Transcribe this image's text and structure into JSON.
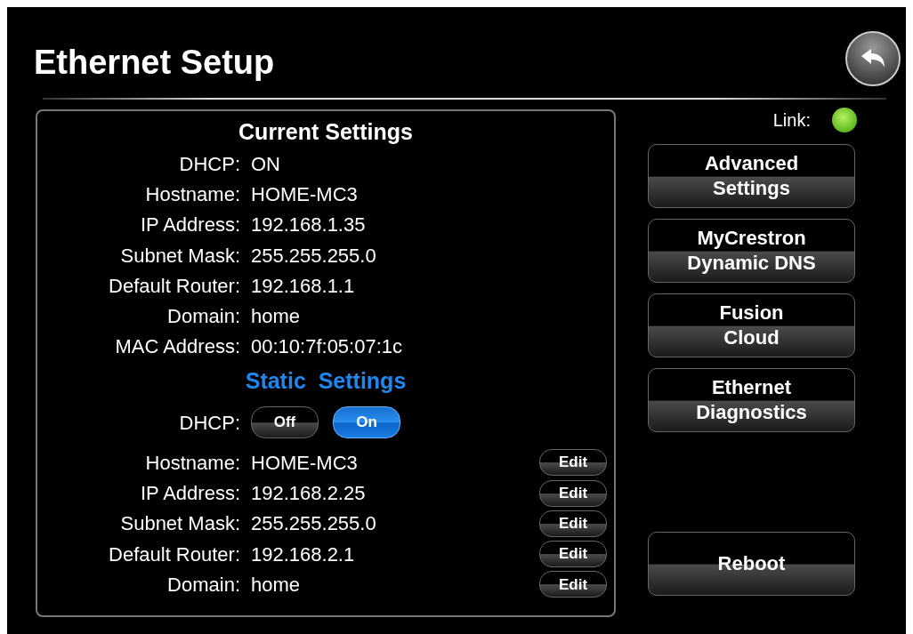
{
  "title": "Ethernet Setup",
  "current": {
    "heading": "Current Settings",
    "rows": [
      {
        "label": "DHCP:",
        "value": "ON"
      },
      {
        "label": "Hostname:",
        "value": "HOME-MC3"
      },
      {
        "label": "IP Address:",
        "value": "192.168.1.35"
      },
      {
        "label": "Subnet Mask:",
        "value": "255.255.255.0"
      },
      {
        "label": "Default Router:",
        "value": "192.168.1.1"
      },
      {
        "label": "Domain:",
        "value": "home"
      },
      {
        "label": "MAC Address:",
        "value": "00:10:7f:05:07:1c"
      }
    ]
  },
  "static": {
    "heading": "Static  Settings",
    "dhcp": {
      "label": "DHCP:",
      "options": [
        {
          "label": "Off",
          "selected": false
        },
        {
          "label": "On",
          "selected": true
        }
      ]
    },
    "rows": [
      {
        "label": "Hostname:",
        "value": "HOME-MC3",
        "button": "Edit"
      },
      {
        "label": "IP Address:",
        "value": "192.168.2.25",
        "button": "Edit"
      },
      {
        "label": "Subnet Mask:",
        "value": "255.255.255.0",
        "button": "Edit"
      },
      {
        "label": "Default Router:",
        "value": "192.168.2.1",
        "button": "Edit"
      },
      {
        "label": "Domain:",
        "value": "home",
        "button": "Edit"
      }
    ]
  },
  "link": {
    "label": "Link:",
    "on": true
  },
  "menu": [
    {
      "lines": [
        "Advanced",
        "Settings"
      ]
    },
    {
      "lines": [
        "MyCrestron",
        "Dynamic DNS"
      ]
    },
    {
      "lines": [
        "Fusion",
        "Cloud"
      ]
    },
    {
      "lines": [
        "Ethernet",
        "Diagnostics"
      ]
    }
  ],
  "reboot": "Reboot"
}
